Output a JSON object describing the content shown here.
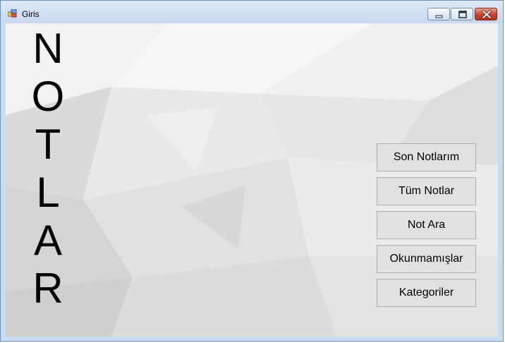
{
  "window": {
    "title": "Giris",
    "icon": "app-form-icon",
    "controls": [
      "minimize-icon",
      "maximize-icon",
      "close-icon"
    ]
  },
  "letters": [
    "N",
    "O",
    "T",
    "L",
    "A",
    "R"
  ],
  "menu": {
    "son_notlarim": "Son Notlarım",
    "tum_notlar": "Tüm Notlar",
    "not_ara": "Not Ara",
    "okunmamislar": "Okunmamışlar",
    "kategoriler": "Kategoriler"
  }
}
